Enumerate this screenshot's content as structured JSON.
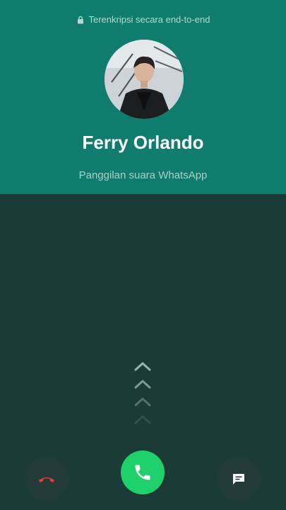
{
  "header": {
    "encryption_text": "Terenkripsi secara end-to-end",
    "caller_name": "Ferry Orlando",
    "call_type": "Panggilan suara WhatsApp"
  },
  "colors": {
    "header_bg": "#0f7c6e",
    "body_bg": "#1b3b37",
    "answer": "#1fd16a",
    "decline_icon": "#ef3b3b"
  },
  "icons": [
    "lock-icon",
    "swipe-up-chevron-icon",
    "decline-call-icon",
    "answer-call-icon",
    "message-icon"
  ]
}
